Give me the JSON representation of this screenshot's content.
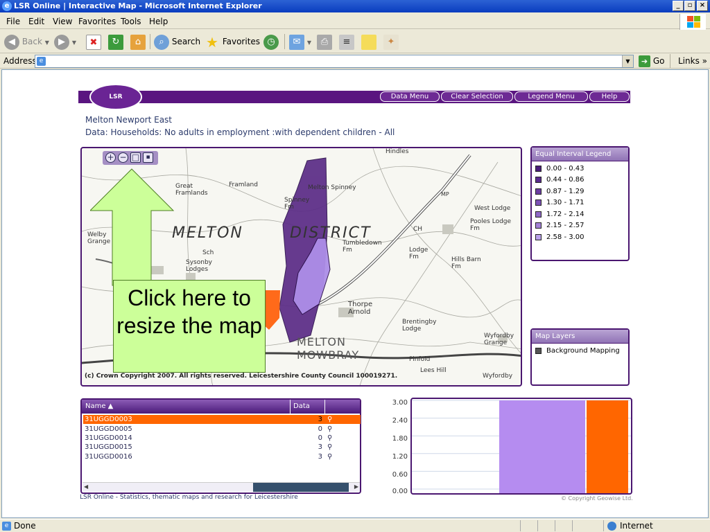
{
  "window": {
    "title": "LSR Online | Interactive Map - Microsoft Internet Explorer"
  },
  "menu": [
    "File",
    "Edit",
    "View",
    "Favorites",
    "Tools",
    "Help"
  ],
  "toolbar": {
    "back": "Back",
    "search": "Search",
    "favorites": "Favorites"
  },
  "address": {
    "label": "Address",
    "value": "",
    "go": "Go",
    "links": "Links"
  },
  "status": {
    "text": "Done",
    "zone": "Internet"
  },
  "banner": {
    "logo": "LSR",
    "buttons": [
      "Data Menu",
      "Clear Selection",
      "Legend Menu",
      "Help"
    ]
  },
  "area_title": "Melton Newport East",
  "data_title": "Data: Households: No adults in employment :with dependent children - All",
  "map": {
    "labels": [
      "MELTON",
      "DISTRICT",
      "MELTON",
      "MOWBRAY",
      "Great Framlands",
      "Welby Grange",
      "Sysonby Lodges",
      "Tumbledown Fm",
      "Lodge Fm",
      "Hills Barn Fm",
      "Brentingby Lodge",
      "Thorpe Arnold",
      "West Lodge",
      "Pooles Lodge Fm",
      "Wyfordby Grange",
      "Wyfordby",
      "Pinfold",
      "Lees Hill",
      "Spinney Fm",
      "Melton Spinney",
      "Hindles",
      "CH",
      "MP",
      "Framland",
      "Sch"
    ],
    "copyright": "(c) Crown Copyright 2007. All rights reserved. Leicestershire County Council 100019271.",
    "callout": "Click here to resize the map"
  },
  "legend": {
    "title": "Equal Interval Legend",
    "items": [
      {
        "label": "0.00 - 0.43",
        "color": "#4b1d7a"
      },
      {
        "label": "0.44 - 0.86",
        "color": "#5b2b8e"
      },
      {
        "label": "0.87 - 1.29",
        "color": "#6c3ea2"
      },
      {
        "label": "1.30 - 1.71",
        "color": "#7d52b6"
      },
      {
        "label": "1.72 - 2.14",
        "color": "#8f68c6"
      },
      {
        "label": "2.15 - 2.57",
        "color": "#a381d6"
      },
      {
        "label": "2.58 - 3.00",
        "color": "#b9a0ea"
      }
    ]
  },
  "layers": {
    "title": "Map Layers",
    "items": [
      "Background Mapping"
    ]
  },
  "table": {
    "headers": [
      "Name ▲",
      "Data"
    ],
    "rows": [
      {
        "name": "31UGGD0003",
        "value": "3",
        "selected": true
      },
      {
        "name": "31UGGD0005",
        "value": "0",
        "selected": false
      },
      {
        "name": "31UGGD0014",
        "value": "0",
        "selected": false
      },
      {
        "name": "31UGGD0015",
        "value": "3",
        "selected": false
      },
      {
        "name": "31UGGD0016",
        "value": "3",
        "selected": false
      }
    ]
  },
  "chart_data": {
    "type": "bar",
    "y_ticks": [
      "3.00",
      "2.40",
      "1.80",
      "1.20",
      "0.60",
      "0.00"
    ],
    "ylim": [
      0,
      3
    ],
    "bars": [
      {
        "value": 3,
        "color": "#b58cf0"
      },
      {
        "value": 3,
        "color": "#ff6600"
      }
    ]
  },
  "footer": "LSR Online - Statistics, thematic maps and research for Leicestershire",
  "geowise": "© Copyright Geowise Ltd."
}
